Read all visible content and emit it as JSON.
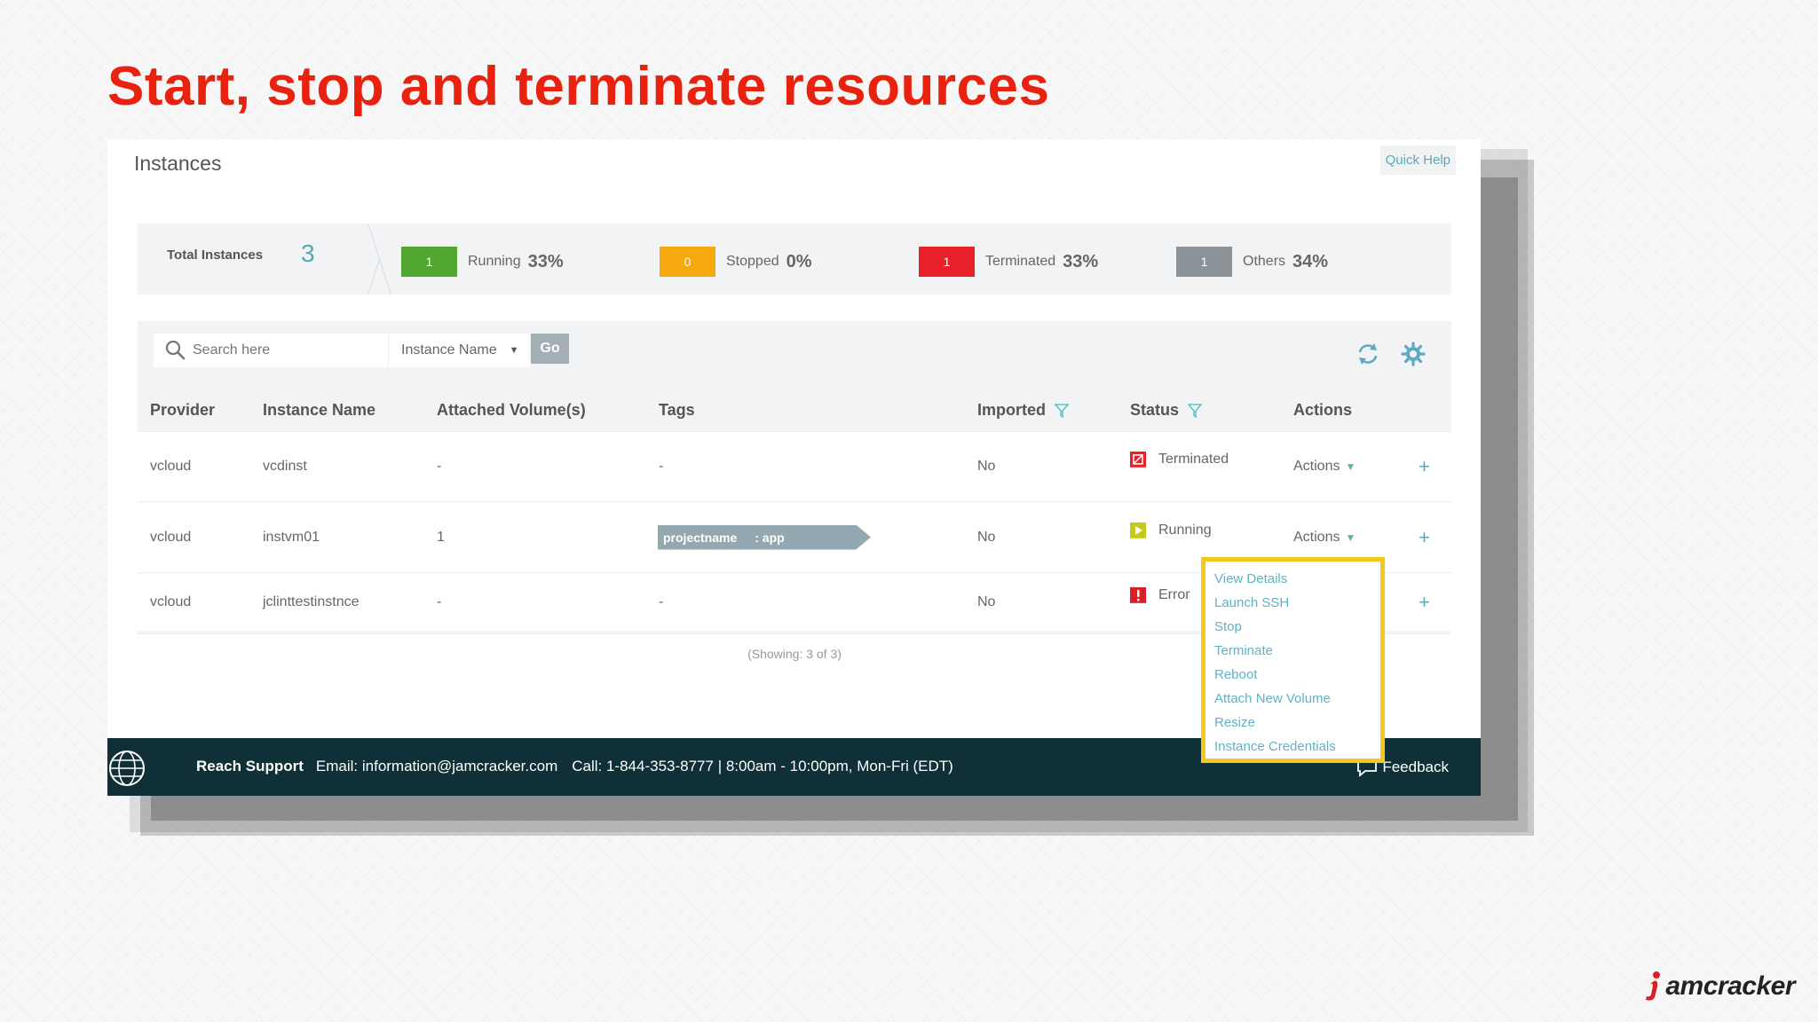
{
  "slide": {
    "title": "Start, stop and terminate resources",
    "logo_text": "amcracker"
  },
  "panel": {
    "title": "Instances",
    "quick_help": "Quick Help"
  },
  "summary": {
    "total_label": "Total Instances",
    "total_value": "3",
    "stats": [
      {
        "count": "1",
        "label": "Running",
        "percent": "33%",
        "color": "#52a632"
      },
      {
        "count": "0",
        "label": "Stopped",
        "percent": "0%",
        "color": "#f6a90e"
      },
      {
        "count": "1",
        "label": "Terminated",
        "percent": "33%",
        "color": "#e8202a"
      },
      {
        "count": "1",
        "label": "Others",
        "percent": "34%",
        "color": "#8c9398"
      }
    ]
  },
  "toolbar": {
    "search_placeholder": "Search here",
    "search_field": "Instance Name",
    "go_label": "Go"
  },
  "table": {
    "columns": [
      "Provider",
      "Instance Name",
      "Attached Volume(s)",
      "Tags",
      "Imported",
      "Status",
      "Actions"
    ],
    "rows": [
      {
        "provider": "vcloud",
        "name": "vcdinst",
        "volumes": "-",
        "tags": "-",
        "imported": "No",
        "status": "Terminated",
        "status_color": "#e8202a",
        "actions": "Actions"
      },
      {
        "provider": "vcloud",
        "name": "instvm01",
        "volumes": "1",
        "tag_key": "projectname",
        "tag_value": ": app",
        "imported": "No",
        "status": "Running",
        "status_color": "#c6c91a",
        "actions": "Actions"
      },
      {
        "provider": "vcloud",
        "name": "jclinttestinstnce",
        "volumes": "-",
        "tags": "-",
        "imported": "No",
        "status": "Error",
        "status_color": "#d81f26"
      }
    ],
    "showing": "(Showing: 3 of 3)"
  },
  "actions_menu": {
    "items": [
      "View Details",
      "Launch SSH",
      "Stop",
      "Terminate",
      "Reboot",
      "Attach New Volume",
      "Resize",
      "Instance Credentials"
    ]
  },
  "support": {
    "reach": "Reach Support",
    "email": "Email: information@jamcracker.com",
    "call": "Call: 1-844-353-8777 | 8:00am - 10:00pm, Mon-Fri (EDT)",
    "feedback": "Feedback"
  }
}
